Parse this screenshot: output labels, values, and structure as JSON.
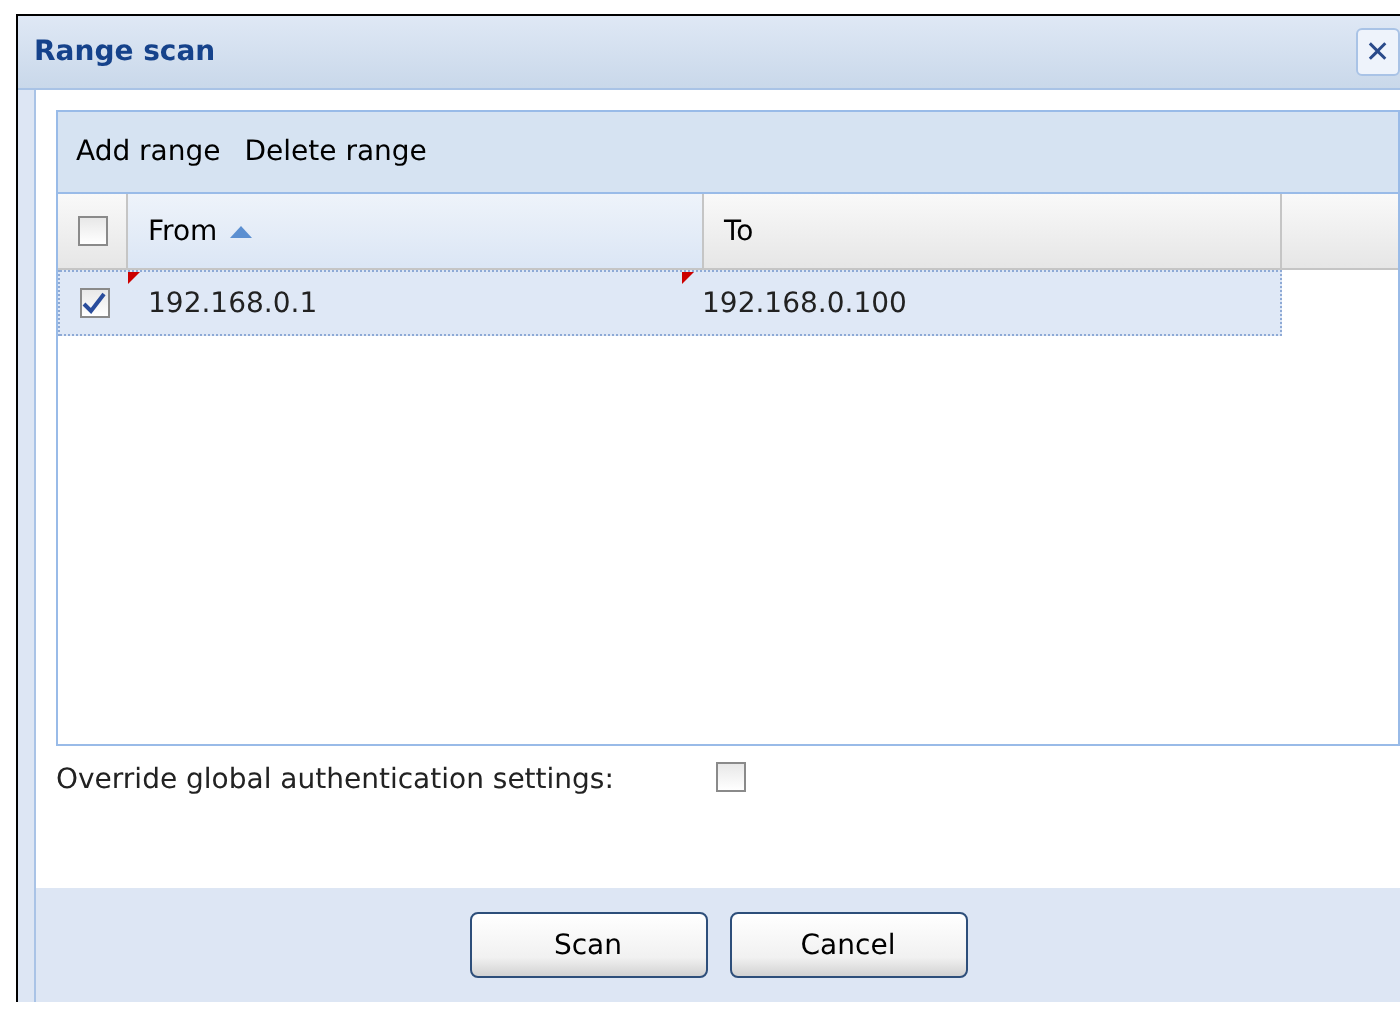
{
  "window": {
    "title": "Range scan",
    "close": "✕"
  },
  "toolbar": [
    "Add range",
    "Delete range"
  ],
  "table": {
    "select_all": false,
    "columns": [
      {
        "label": "From",
        "sorted": true
      },
      {
        "label": "To",
        "sorted": false
      }
    ],
    "rows": [
      {
        "checked": true,
        "selected": true,
        "cells": [
          {
            "text": "192.168.0.1",
            "modified": true
          },
          {
            "text": "192.168.0.100",
            "modified": true
          }
        ]
      }
    ]
  },
  "override": {
    "label": "Override global authentication settings:",
    "checked": false
  },
  "buttons": [
    "Scan",
    "Cancel"
  ]
}
